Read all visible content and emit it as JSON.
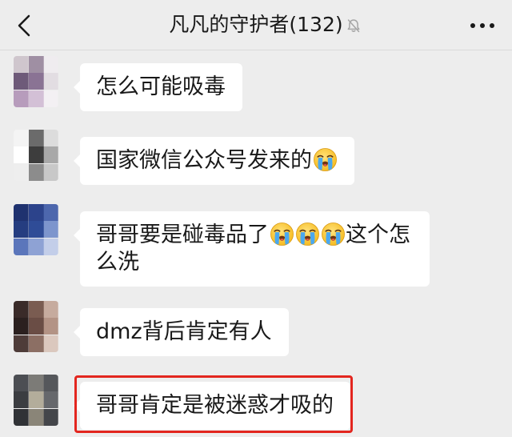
{
  "header": {
    "back_icon": "chevron-left-icon",
    "title": "凡凡的守护者(132)",
    "muted_icon": "bell-slash-icon",
    "more_icon": "more-dots-icon"
  },
  "theme": {
    "background": "#ededed",
    "bubble": "#ffffff",
    "text": "#191919",
    "muted_icon": "#a6a6a6",
    "highlight_border": "#e3261f"
  },
  "messages": [
    {
      "segments": [
        {
          "text": "怎么可能吸毒"
        }
      ]
    },
    {
      "segments": [
        {
          "text": "国家微信公众号发来的"
        },
        {
          "emoji": "loudly-crying-face"
        }
      ]
    },
    {
      "segments": [
        {
          "text": "哥哥要是碰毒品了"
        },
        {
          "emoji": "loudly-crying-face"
        },
        {
          "emoji": "loudly-crying-face"
        },
        {
          "emoji": "loudly-crying-face"
        },
        {
          "text": "这个怎么洗"
        }
      ]
    },
    {
      "segments": [
        {
          "text": "dmz背后肯定有人"
        }
      ]
    },
    {
      "segments": [
        {
          "text": "哥哥肯定是被迷惑才吸的"
        }
      ],
      "highlighted": true
    }
  ]
}
